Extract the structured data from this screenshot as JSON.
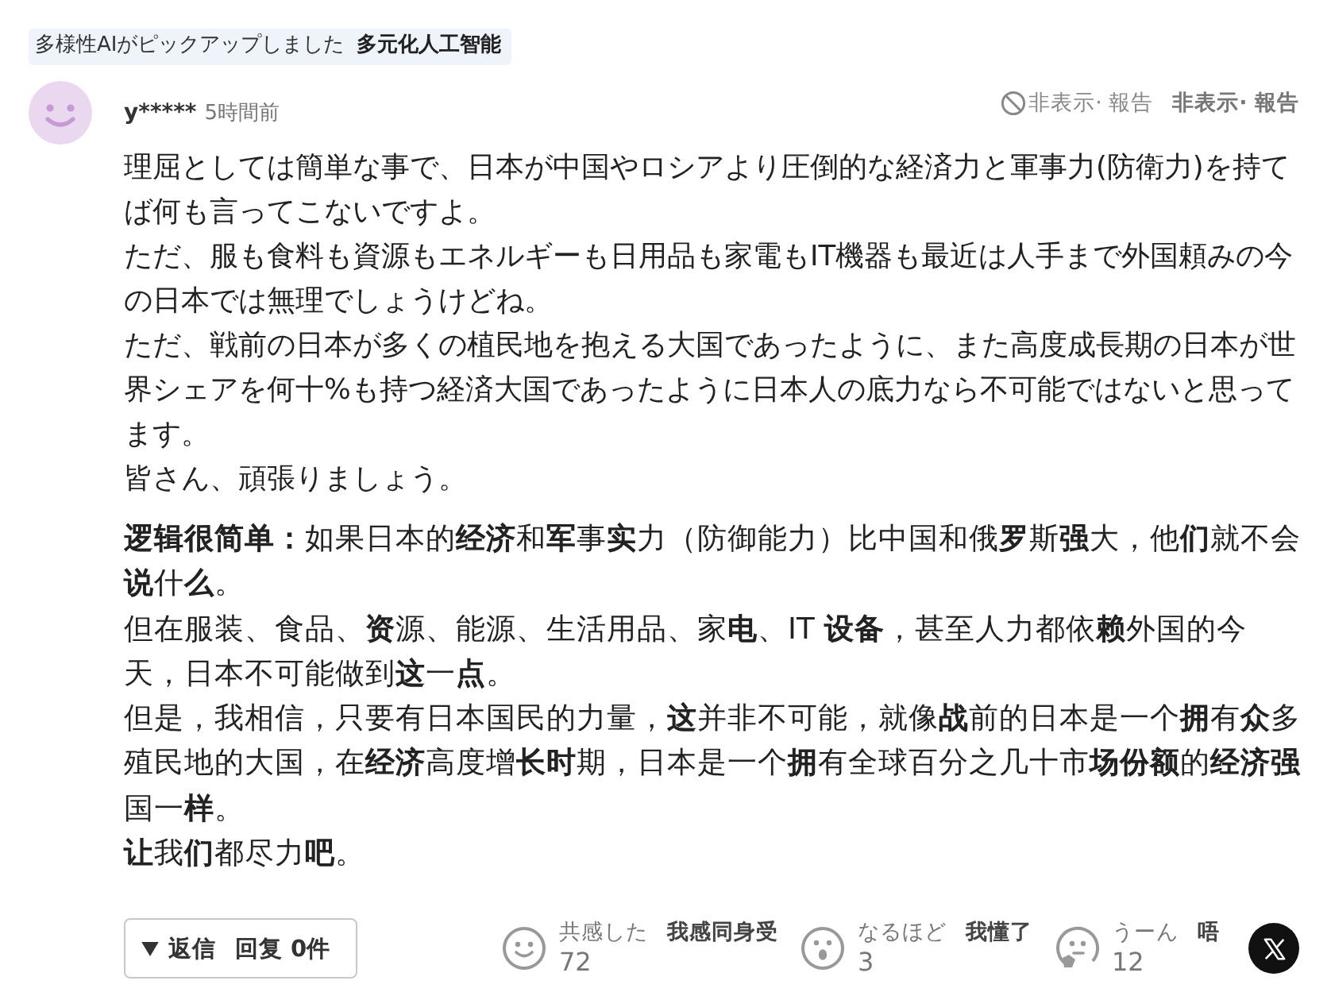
{
  "banner": {
    "label": "多様性AIがピックアップしました",
    "translation": "多元化人工智能"
  },
  "comment": {
    "user": "y*****",
    "time": "5時間前",
    "actions": [
      {
        "kind": "original",
        "text": "非表示· 報告"
      },
      {
        "kind": "translated",
        "text": "非表示· 報告"
      }
    ]
  },
  "body": [
    "理屈としては簡単な事で、日本が中国やロシアより圧倒的な経済力と軍事力(防衛力)を持てば何も言ってこないですよ。",
    "ただ、服も食料も資源もエネルギーも日用品も家電もIT機器も最近は人手まで外国頼みの今の日本では無理でしょうけどね。",
    "ただ、戦前の日本が多くの植民地を抱える大国であったように、また高度成長期の日本が世界シェアを何十%も持つ経済大国であったように日本人の底力なら不可能ではないと思ってます。",
    "皆さん、頑張りましょう。"
  ],
  "translation": [
    "**逻辑很简单：**如果日本的**经济**和**军**事**实**力（防御能力）比中国和俄**罗**斯**强**大，他**们**就不会**说**什**么**。",
    "但在服装、食品、**资**源、能源、生活用品、家**电**、IT **设备**，甚至人力都依**赖**外国的今天，日本不可能做到**这**一**点**。",
    "但是，我相信，只要有日本国民的力量，**这**并非不可能，就像**战**前的日本是一个**拥**有**众**多殖民地的大国，在**经济**高度增**长时**期，日本是一个**拥**有全球百分之几十市**场份额**的**经济强**国一**样**。",
    "**让**我**们**都尽力**吧**。"
  ],
  "reply_button": {
    "label": "返信",
    "translation": "回复 0件"
  },
  "reactions": [
    {
      "kind": "smile",
      "label": "共感した",
      "translation": "我感同身受",
      "count": "72"
    },
    {
      "kind": "surprise",
      "label": "なるほど",
      "translation": "我懂了",
      "count": "3"
    },
    {
      "kind": "hmm",
      "label": "うーん",
      "translation": "唔",
      "count": "12"
    }
  ]
}
